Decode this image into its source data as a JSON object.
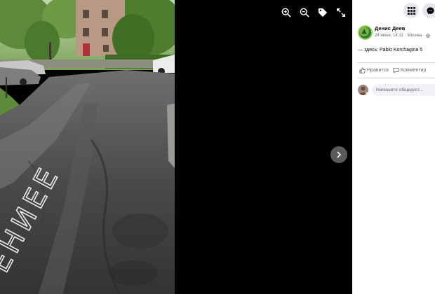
{
  "post": {
    "author": "Денис Деев",
    "date": "24 июня, 14:11",
    "separator": "·",
    "city": "Москва",
    "location": "— здесь: Pablo Korchagina 5"
  },
  "actions": {
    "like": "Нравится",
    "comment": "Комментир"
  },
  "comment_box": {
    "placeholder": "Напишите общедост..."
  },
  "photo_text": "ЕНИЕЕ",
  "viewer_icons": [
    "zoom-in-icon",
    "zoom-out-icon",
    "tag-icon",
    "fullscreen-icon"
  ],
  "colors": {
    "viewer_bg": "#000000",
    "panel_bg": "#ffffff",
    "secondary_text": "#65676b"
  }
}
